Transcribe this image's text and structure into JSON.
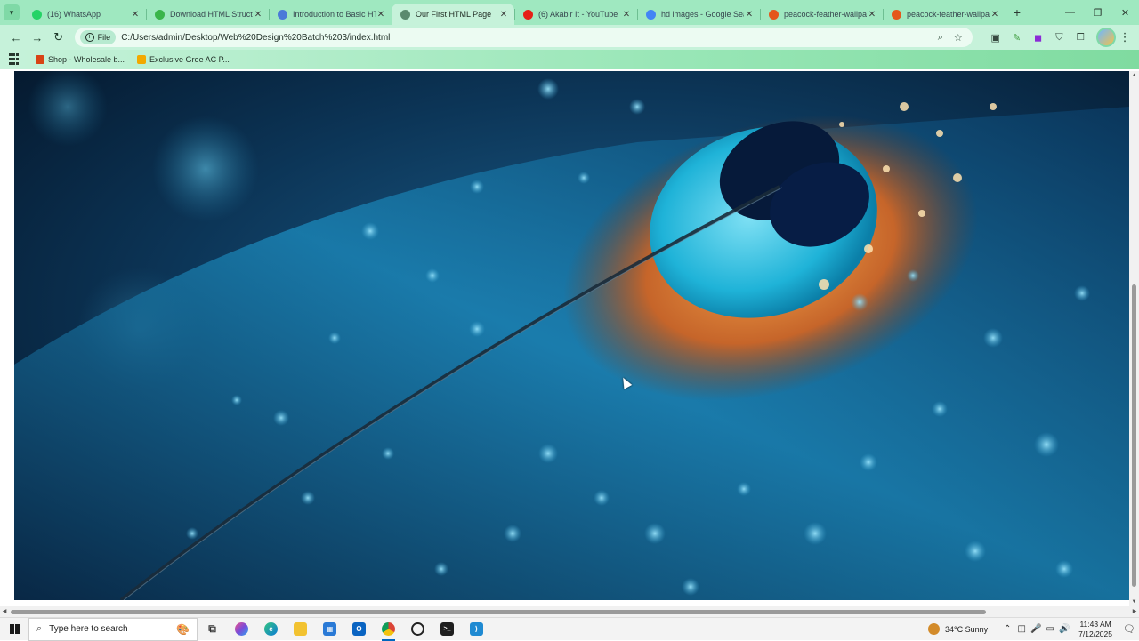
{
  "browser": {
    "tabs": [
      {
        "title": "(16) WhatsApp",
        "favicon_color": "#25d366",
        "active": false
      },
      {
        "title": "Download HTML Structure",
        "favicon_color": "#3ab54a",
        "active": false
      },
      {
        "title": "Introduction to Basic HTML",
        "favicon_color": "#4b7bd8",
        "active": false
      },
      {
        "title": "Our First HTML Page",
        "favicon_color": "#5a8a6e",
        "active": true
      },
      {
        "title": "(6) Akabir It - YouTube",
        "favicon_color": "#e62117",
        "active": false
      },
      {
        "title": "hd images - Google Search",
        "favicon_color": "#4285f4",
        "active": false
      },
      {
        "title": "peacock-feather-wallpaper",
        "favicon_color": "#e4571b",
        "active": false
      },
      {
        "title": "peacock-feather-wallpaper",
        "favicon_color": "#e4571b",
        "active": false
      }
    ],
    "new_tab": "+",
    "window_controls": {
      "minimize": "—",
      "restore": "❐",
      "close": "✕"
    },
    "toolbar": {
      "back": "←",
      "forward": "→",
      "reload": "↻",
      "site_chip": "File",
      "url": "C:/Users/admin/Desktop/Web%20Design%20Batch%203/index.html",
      "zoom_icon": "⌕",
      "bookmark_icon": "☆",
      "menu": "⋮"
    },
    "bookmarks": [
      {
        "label": "Shop - Wholesale b...",
        "color": "#d84315"
      },
      {
        "label": "Exclusive Gree AC P...",
        "color": "#f2a900"
      }
    ]
  },
  "page": {
    "image_alt": "Peacock feather close-up with water droplets"
  },
  "taskbar": {
    "search_placeholder": "Type here to search",
    "apps": [
      {
        "name": "task-view",
        "glyph": "⧉",
        "color": "#333333"
      },
      {
        "name": "copilot",
        "glyph": "◆",
        "color": "#7b4bd8"
      },
      {
        "name": "edge",
        "glyph": "e",
        "color": "#0c7bd4"
      },
      {
        "name": "file-explorer",
        "glyph": "▭",
        "color": "#e8b400"
      },
      {
        "name": "store",
        "glyph": "▦",
        "color": "#2a7ad6"
      },
      {
        "name": "outlook",
        "glyph": "O",
        "color": "#0a64c2"
      },
      {
        "name": "chrome",
        "glyph": "●",
        "color": "#2fa24b"
      },
      {
        "name": "opera-gx",
        "glyph": "◎",
        "color": "#222222"
      },
      {
        "name": "terminal",
        "glyph": ">_",
        "color": "#1e1e1e"
      },
      {
        "name": "vscode",
        "glyph": "⟩",
        "color": "#1f8ad2"
      }
    ],
    "weather": "34°C  Sunny",
    "time": "11:43 AM",
    "date": "7/12/2025"
  }
}
